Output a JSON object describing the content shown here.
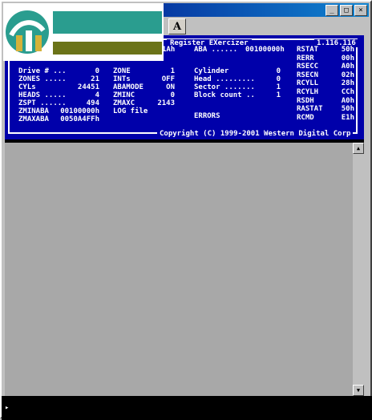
{
  "window": {
    "controls": {
      "minimize": "_",
      "maximize": "□",
      "close": "×"
    },
    "font_button": "A"
  },
  "console": {
    "title": "Register EXercizer",
    "title_prefix": "R",
    "version": "1.116.116",
    "copyright": "Copyright (C) 1999-2001 Western Digital Corp",
    "col1": [
      {
        "label": "Drive # ...",
        "value": "0"
      },
      {
        "label": "ZONES .....",
        "value": "21"
      },
      {
        "label": "CYLs",
        "value": "24451"
      },
      {
        "label": "HEADS .....",
        "value": "4"
      },
      {
        "label": "ZSPT ......",
        "value": "494"
      },
      {
        "label": "ZMINABA",
        "value": "00100000h"
      },
      {
        "label": "ZMAXABA",
        "value": "0050A4FFh"
      }
    ],
    "col2": [
      {
        "label": "ZONE",
        "value": "1"
      },
      {
        "label": "INTs",
        "value": "OFF"
      },
      {
        "label": "ABAMODE",
        "value": "ON"
      },
      {
        "label": "ZMINC",
        "value": "0"
      },
      {
        "label": "ZMAXC",
        "value": "2143"
      },
      {
        "label": "LOG file",
        "value": ""
      }
    ],
    "col2_top_value": "1Ah",
    "col3_aba": {
      "label": "ABA ......",
      "value": "00100000h"
    },
    "col3": [
      {
        "label": "Cylinder",
        "value": "0"
      },
      {
        "label": "Head .........",
        "value": "0"
      },
      {
        "label": "Sector .......",
        "value": "1"
      },
      {
        "label": "Block count ..",
        "value": "1"
      }
    ],
    "errors_label": "ERRORS",
    "registers": [
      {
        "name": "RSTAT",
        "value": "50h"
      },
      {
        "name": "RERR",
        "value": "00h"
      },
      {
        "name": "RSECC",
        "value": "A0h"
      },
      {
        "name": "RSECN",
        "value": "02h"
      },
      {
        "name": "RCYLL",
        "value": "28h"
      },
      {
        "name": "RCYLH",
        "value": "CCh"
      },
      {
        "name": "RSDH",
        "value": "A0h"
      },
      {
        "name": "RASTAT",
        "value": "50h"
      },
      {
        "name": "RCMD",
        "value": "E1h"
      }
    ]
  },
  "command_line": {
    "prompt": "▸"
  },
  "colors": {
    "console_bg": "#0000aa",
    "console_fg": "#ffffff",
    "logo_teal": "#2a9d8f",
    "logo_olive": "#6b7318"
  }
}
